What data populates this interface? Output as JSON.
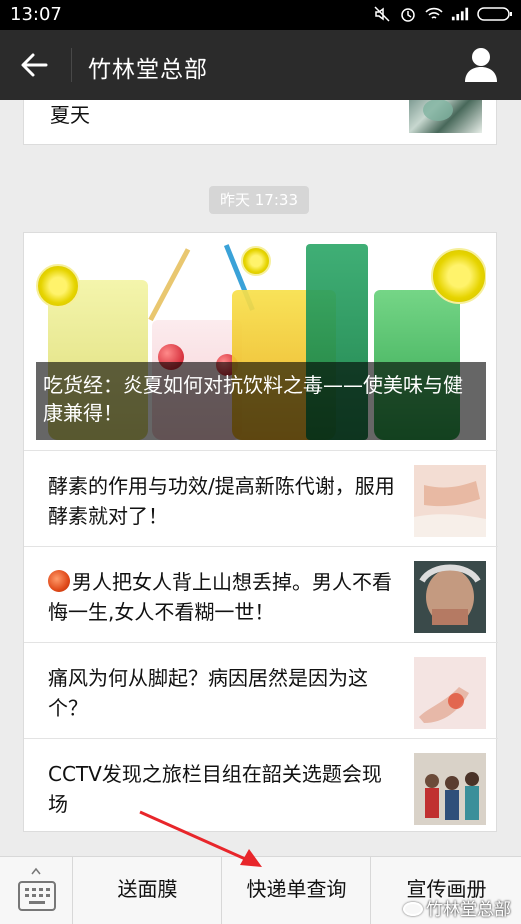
{
  "status_bar": {
    "time": "13:07",
    "icons": [
      "mute-icon",
      "alarm-icon",
      "wifi-icon",
      "signal-icon",
      "battery-icon"
    ]
  },
  "nav": {
    "title": "竹林堂总部",
    "back_icon": "back-arrow-icon",
    "profile_icon": "user-profile-icon"
  },
  "feed": {
    "previous_card_title": "夏天",
    "timestamp": "昨天 17:33",
    "cover_caption": "吃货经：炎夏如何对抗饮料之毒——使美味与健康兼得！",
    "items": [
      {
        "title": "酵素的作用与功效/提高新陈代谢，服用酵素就对了！"
      },
      {
        "title": "男人把女人背上山想丢掉。男人不看悔一生,女人不看糊一世！",
        "emoji": "rose"
      },
      {
        "title": "痛风为何从脚起？病因居然是因为这个？"
      },
      {
        "title": "CCTV发现之旅栏目组在韶关选题会现场"
      }
    ]
  },
  "bottom_menu": {
    "keyboard_icon": "keyboard-icon",
    "items": [
      "送面膜",
      "快递单查询",
      "宣传画册"
    ]
  },
  "watermark": "竹林堂总部",
  "colors": {
    "nav_bg": "#2b2b2b",
    "page_bg": "#ececec",
    "annotation_arrow": "#e8262b"
  }
}
